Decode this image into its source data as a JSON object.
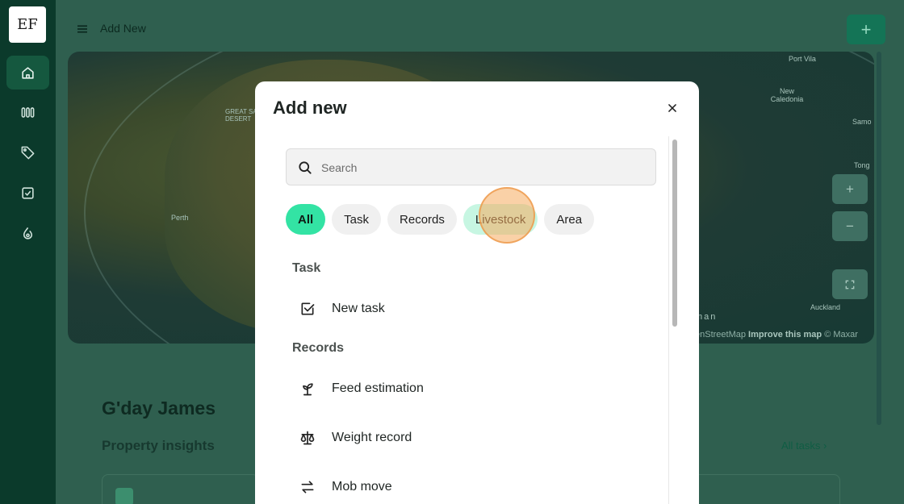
{
  "sidebar": {
    "logo": "EF",
    "items": [
      {
        "icon": "home-icon",
        "active": true
      },
      {
        "icon": "paddocks-icon",
        "active": false
      },
      {
        "icon": "tag-icon",
        "active": false
      },
      {
        "icon": "task-check-icon",
        "active": false
      },
      {
        "icon": "livestock-icon",
        "active": false
      }
    ]
  },
  "topbar": {
    "title": "Add New",
    "add_label": "+"
  },
  "map": {
    "labels": {
      "perth": "Perth",
      "port_vila": "Port Vila",
      "new_caledonia": "New Caledonia",
      "samoa": "Samo",
      "tonga": "Tong",
      "auckland": "Auckland",
      "tasman": "man",
      "desert": "GREAT SANDY DESERT"
    },
    "zoom_in": "+",
    "zoom_out": "−",
    "attribution_prefix": "enStreetMap",
    "attribution_improve": "Improve this map",
    "attribution_suffix": "© Maxar"
  },
  "dashboard": {
    "greeting": "G'day James",
    "insights_title": "Property insights",
    "all_tasks": "All tasks"
  },
  "modal": {
    "title": "Add new",
    "search_placeholder": "Search",
    "filters": [
      "All",
      "Task",
      "Records",
      "Livestock",
      "Area"
    ],
    "active_filter": "All",
    "hovered_filter": "Livestock",
    "sections": [
      {
        "label": "Task",
        "items": [
          {
            "label": "New task",
            "icon": "checkbox-icon"
          }
        ]
      },
      {
        "label": "Records",
        "items": [
          {
            "label": "Feed estimation",
            "icon": "sprout-icon"
          },
          {
            "label": "Weight record",
            "icon": "scale-icon"
          },
          {
            "label": "Mob move",
            "icon": "arrows-swap-icon"
          }
        ]
      }
    ]
  },
  "colors": {
    "sidebar_bg": "#0b3a2b",
    "accent": "#33e3a4",
    "primary_button": "#147456",
    "overlay_main": "#2f5f4f"
  }
}
